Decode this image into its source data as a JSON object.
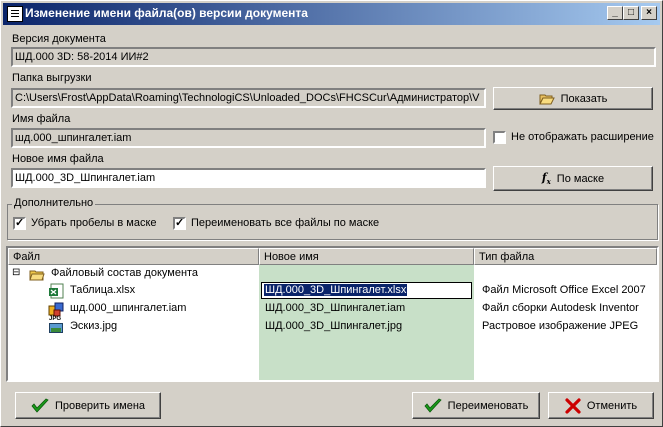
{
  "window": {
    "title": "Изменение имени файла(ов) версии  документа",
    "controls": [
      "_",
      "□",
      "×"
    ]
  },
  "doc_version": {
    "label": "Версия документа",
    "value": "ШД.000 3D: 58-2014 ИИ#2"
  },
  "export_folder": {
    "label": "Папка выгрузки",
    "value": "C:\\Users\\Frost\\AppData\\Roaming\\TechnologiCS\\Unloaded_DOCs\\FHCSCur\\Администратор\\V",
    "show_button": "Показать"
  },
  "file_name": {
    "label": "Имя файла",
    "value": "шд.000_шпингалет.iam",
    "hide_ext_label": "Не отображать расширение",
    "hide_ext_checked": false
  },
  "new_file_name": {
    "label": "Новое имя файла",
    "value": "ШД.000_3D_Шпингалет.iam",
    "mask_button": "По маске"
  },
  "additional": {
    "label": "Дополнительно",
    "remove_spaces_label": "Убрать пробелы в маске",
    "remove_spaces_checked": true,
    "rename_all_label": "Переименовать все файлы по маске",
    "rename_all_checked": true
  },
  "grid": {
    "columns": [
      "Файл",
      "Новое имя",
      "Тип файла"
    ],
    "root": {
      "expander": "⊟",
      "label": "Файловый состав документа"
    },
    "rows": [
      {
        "file": "Таблица.xlsx",
        "new_name": "ШД.000_3D_Шпингалет.xlsx",
        "type": "Файл Microsoft Office Excel 2007",
        "icon": "excel-icon",
        "editing": true
      },
      {
        "file": "шд.000_шпингалет.iam",
        "new_name": "ШД.000_3D_Шпингалет.iam",
        "type": "Файл сборки Autodesk Inventor",
        "icon": "inventor-assembly-icon",
        "editing": false
      },
      {
        "file": "Эскиз.jpg",
        "new_name": "ШД.000_3D_Шпингалет.jpg",
        "type": "Растровое изображение JPEG",
        "icon": "jpeg-icon",
        "icon_text": "JPG",
        "editing": false
      }
    ]
  },
  "buttons": {
    "check": "Проверить имена",
    "rename": "Переименовать",
    "cancel": "Отменить"
  },
  "colors": {
    "title_start": "#0a246a",
    "title_end": "#a6caf0",
    "new_name_column": "#c8e0c8",
    "selection": "#0a246a",
    "check_green": "#1a9a1a",
    "cancel_red": "#cc0000"
  }
}
